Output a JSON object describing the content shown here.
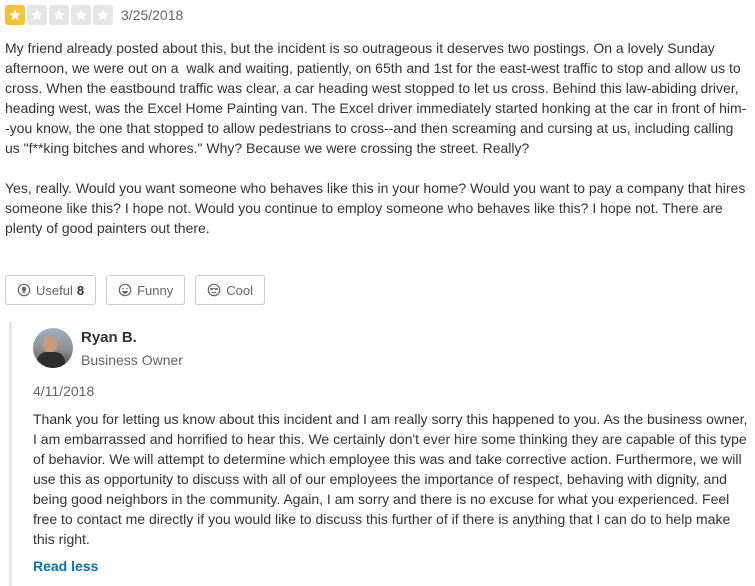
{
  "review": {
    "rating": 1,
    "max_rating": 5,
    "date": "3/25/2018",
    "paragraphs": [
      "My friend already posted about this, but the incident is so outrageous it deserves two postings. On a lovely Sunday afternoon, we were out on a  walk and waiting, patiently, on 65th and 1st for the east-west traffic to stop and allow us to cross. When the eastbound traffic was clear, a car heading west stopped to let us cross. Behind this law-abiding driver, heading west, was the Excel Home Painting van. The Excel driver immediately started honking at the car in front of him--you know, the one that stopped to allow pedestrians to cross--and then screaming and cursing at us, including calling us \"f**king bitches and whores.\" Why? Because we were crossing the street. Really?",
      "Yes, really. Would you want someone who behaves like this in your home? Would you want to pay a company that hires someone like this? I hope not. Would you continue to employ someone who behaves like this? I hope not. There are plenty of good painters out there."
    ]
  },
  "votes": {
    "useful_label": "Useful",
    "useful_count": "8",
    "funny_label": "Funny",
    "cool_label": "Cool"
  },
  "owner_response": {
    "name": "Ryan B.",
    "role": "Business Owner",
    "date": "4/11/2018",
    "text": "Thank you for letting us know about this incident and I am really sorry this happened to you.  As the business owner, I am embarrassed and horrified to hear this.  We certainly don't ever hire some thinking they are capable of this type of behavior.  We will attempt to determine which employee this was and take corrective action.  Furthermore, we will use this as opportunity to discuss with all of our employees the importance of respect, behaving with dignity, and being good neighbors in the community.  Again, I am sorry and there is no excuse for what you experienced.  Feel free to contact me directly if you would like to discuss this further of if there is anything that I can do to help make this right.",
    "read_less_label": "Read less"
  },
  "colors": {
    "star_filled": "#f8c12f",
    "star_empty": "#e6e6e6",
    "link": "#0073bb"
  },
  "icons": {
    "useful": "lightbulb-icon",
    "funny": "smile-icon",
    "cool": "sunglasses-icon",
    "star": "star-icon"
  }
}
